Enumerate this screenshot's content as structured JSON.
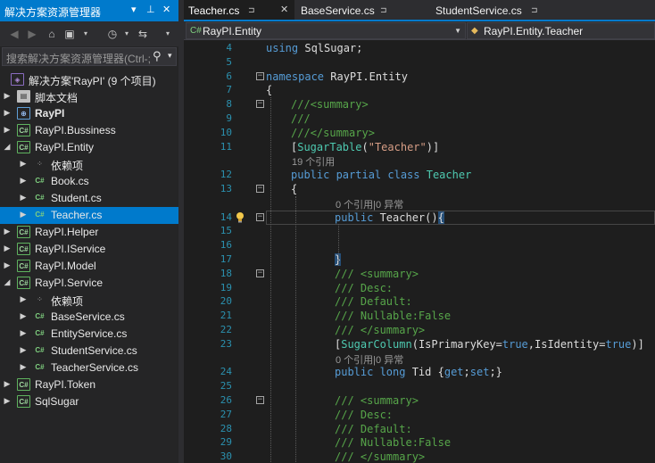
{
  "explorer": {
    "title": "解决方案资源管理器",
    "title_controls": [
      "▾",
      "⊥",
      "✕"
    ],
    "search_placeholder": "搜索解决方案资源管理器(Ctrl-;)",
    "toolbar_icons": [
      "back-icon",
      "forward-icon",
      "home-icon",
      "switch-view-icon",
      "history-icon",
      "sync-icon"
    ],
    "tree": [
      {
        "label": "解决方案'RayPI' (9 个项目)",
        "icon": "solution-icon",
        "ico": "◈",
        "indent": 0,
        "arrow": "",
        "bold": false,
        "selected": false
      },
      {
        "label": "脚本文档",
        "icon": "folder-doc-icon",
        "ico": "▤",
        "indent": 1,
        "arrow": "▶",
        "bold": false,
        "selected": false
      },
      {
        "label": "RayPI",
        "icon": "web-project-icon",
        "ico": "⊕",
        "indent": 1,
        "arrow": "▶",
        "bold": true,
        "selected": false
      },
      {
        "label": "RayPI.Bussiness",
        "icon": "csharp-project-icon",
        "ico": "C#",
        "indent": 1,
        "arrow": "▶",
        "bold": false,
        "selected": false
      },
      {
        "label": "RayPI.Entity",
        "icon": "csharp-project-icon",
        "ico": "C#",
        "indent": 1,
        "arrow": "◢",
        "bold": false,
        "selected": false
      },
      {
        "label": "依赖项",
        "icon": "dependencies-icon",
        "ico": "⁘",
        "indent": 2,
        "arrow": "▶",
        "bold": false,
        "selected": false
      },
      {
        "label": "Book.cs",
        "icon": "csharp-file-icon",
        "ico": "C#",
        "indent": 2,
        "arrow": "▶",
        "bold": false,
        "selected": false
      },
      {
        "label": "Student.cs",
        "icon": "csharp-file-icon",
        "ico": "C#",
        "indent": 2,
        "arrow": "▶",
        "bold": false,
        "selected": false
      },
      {
        "label": "Teacher.cs",
        "icon": "csharp-file-icon",
        "ico": "C#",
        "indent": 2,
        "arrow": "▶",
        "bold": false,
        "selected": true
      },
      {
        "label": "RayPI.Helper",
        "icon": "csharp-project-icon",
        "ico": "C#",
        "indent": 1,
        "arrow": "▶",
        "bold": false,
        "selected": false
      },
      {
        "label": "RayPI.IService",
        "icon": "csharp-project-icon",
        "ico": "C#",
        "indent": 1,
        "arrow": "▶",
        "bold": false,
        "selected": false
      },
      {
        "label": "RayPI.Model",
        "icon": "csharp-project-icon",
        "ico": "C#",
        "indent": 1,
        "arrow": "▶",
        "bold": false,
        "selected": false
      },
      {
        "label": "RayPI.Service",
        "icon": "csharp-project-icon",
        "ico": "C#",
        "indent": 1,
        "arrow": "◢",
        "bold": false,
        "selected": false
      },
      {
        "label": "依赖项",
        "icon": "dependencies-icon",
        "ico": "⁘",
        "indent": 2,
        "arrow": "▶",
        "bold": false,
        "selected": false
      },
      {
        "label": "BaseService.cs",
        "icon": "csharp-file-icon",
        "ico": "C#",
        "indent": 2,
        "arrow": "▶",
        "bold": false,
        "selected": false
      },
      {
        "label": "EntityService.cs",
        "icon": "csharp-file-icon",
        "ico": "C#",
        "indent": 2,
        "arrow": "▶",
        "bold": false,
        "selected": false
      },
      {
        "label": "StudentService.cs",
        "icon": "csharp-file-icon",
        "ico": "C#",
        "indent": 2,
        "arrow": "▶",
        "bold": false,
        "selected": false
      },
      {
        "label": "TeacherService.cs",
        "icon": "csharp-file-icon",
        "ico": "C#",
        "indent": 2,
        "arrow": "▶",
        "bold": false,
        "selected": false
      },
      {
        "label": "RayPI.Token",
        "icon": "csharp-project-icon",
        "ico": "C#",
        "indent": 1,
        "arrow": "▶",
        "bold": false,
        "selected": false
      },
      {
        "label": "SqlSugar",
        "icon": "csharp-project-icon",
        "ico": "C#",
        "indent": 1,
        "arrow": "▶",
        "bold": false,
        "selected": false
      }
    ]
  },
  "tabs": [
    {
      "label": "Teacher.cs",
      "pin": "⊐",
      "close": "✕",
      "active": true
    },
    {
      "label": "BaseService.cs",
      "pin": "⊐",
      "close": "",
      "active": false
    },
    {
      "label": "StudentService.cs",
      "pin": "⊐",
      "close": "",
      "active": false
    }
  ],
  "navbar": {
    "project": "RayPI.Entity",
    "type": "RayPI.Entity.Teacher"
  },
  "editor": {
    "lines": [
      {
        "n": "4",
        "fold": "",
        "indent": 0,
        "parts": [
          [
            "kw",
            "using"
          ],
          [
            "pl",
            " SqlSugar;"
          ]
        ]
      },
      {
        "n": "5",
        "fold": "",
        "indent": 0,
        "parts": []
      },
      {
        "n": "6",
        "fold": "−",
        "indent": 0,
        "parts": [
          [
            "kw",
            "namespace"
          ],
          [
            "pl",
            " RayPI.Entity"
          ]
        ]
      },
      {
        "n": "7",
        "fold": "",
        "indent": 0,
        "parts": [
          [
            "pl",
            "{"
          ]
        ]
      },
      {
        "n": "8",
        "fold": "−",
        "indent": 1,
        "parts": [
          [
            "doc",
            "///"
          ],
          [
            "tag",
            "<summary>"
          ]
        ]
      },
      {
        "n": "9",
        "fold": "",
        "indent": 1,
        "parts": [
          [
            "doc",
            "///"
          ]
        ]
      },
      {
        "n": "10",
        "fold": "",
        "indent": 1,
        "parts": [
          [
            "doc",
            "///"
          ],
          [
            "tag",
            "</summary>"
          ]
        ]
      },
      {
        "n": "11",
        "fold": "",
        "indent": 1,
        "parts": [
          [
            "pl",
            "["
          ],
          [
            "ty",
            "SugarTable"
          ],
          [
            "pl",
            "("
          ],
          [
            "str",
            "\"Teacher\""
          ],
          [
            "pl",
            ")]"
          ]
        ]
      },
      {
        "n": "",
        "lens": "19 个引用",
        "indent": 1
      },
      {
        "n": "12",
        "fold": "",
        "indent": 1,
        "parts": [
          [
            "kw",
            "public partial class"
          ],
          [
            "pl",
            " "
          ],
          [
            "ty",
            "Teacher"
          ]
        ]
      },
      {
        "n": "13",
        "fold": "−",
        "indent": 1,
        "parts": [
          [
            "pl",
            "{"
          ]
        ]
      },
      {
        "n": "",
        "lens": "0 个引用|0 异常",
        "indent": 2
      },
      {
        "n": "14",
        "fold": "−",
        "indent": 2,
        "bulb": true,
        "current": true,
        "parts": [
          [
            "kw",
            "public"
          ],
          [
            "pl",
            " Teacher()"
          ],
          [
            "brace",
            "{"
          ]
        ]
      },
      {
        "n": "15",
        "fold": "",
        "indent": 2,
        "parts": []
      },
      {
        "n": "16",
        "fold": "",
        "indent": 2,
        "parts": []
      },
      {
        "n": "17",
        "fold": "",
        "indent": 2,
        "parts": [
          [
            "brace",
            "}"
          ]
        ]
      },
      {
        "n": "18",
        "fold": "−",
        "indent": 2,
        "parts": [
          [
            "cm",
            "/// <summary>"
          ]
        ]
      },
      {
        "n": "19",
        "fold": "",
        "indent": 2,
        "parts": [
          [
            "cm",
            "/// Desc:"
          ]
        ]
      },
      {
        "n": "20",
        "fold": "",
        "indent": 2,
        "parts": [
          [
            "cm",
            "/// Default:"
          ]
        ]
      },
      {
        "n": "21",
        "fold": "",
        "indent": 2,
        "parts": [
          [
            "cm",
            "/// Nullable:False"
          ]
        ]
      },
      {
        "n": "22",
        "fold": "",
        "indent": 2,
        "parts": [
          [
            "cm",
            "/// </summary>"
          ]
        ]
      },
      {
        "n": "23",
        "fold": "",
        "indent": 2,
        "parts": [
          [
            "pl",
            "["
          ],
          [
            "ty",
            "SugarColumn"
          ],
          [
            "pl",
            "(IsPrimaryKey="
          ],
          [
            "kw",
            "true"
          ],
          [
            "pl",
            ",IsIdentity="
          ],
          [
            "kw",
            "true"
          ],
          [
            "pl",
            ")]"
          ]
        ]
      },
      {
        "n": "",
        "lens": "0 个引用|0 异常",
        "indent": 2
      },
      {
        "n": "24",
        "fold": "",
        "indent": 2,
        "parts": [
          [
            "kw",
            "public long"
          ],
          [
            "pl",
            " Tid {"
          ],
          [
            "kw",
            "get"
          ],
          [
            "pl",
            ";"
          ],
          [
            "kw",
            "set"
          ],
          [
            "pl",
            ";}"
          ]
        ]
      },
      {
        "n": "25",
        "fold": "",
        "indent": 2,
        "parts": []
      },
      {
        "n": "26",
        "fold": "−",
        "indent": 2,
        "parts": [
          [
            "cm",
            "/// <summary>"
          ]
        ]
      },
      {
        "n": "27",
        "fold": "",
        "indent": 2,
        "parts": [
          [
            "cm",
            "/// Desc:"
          ]
        ]
      },
      {
        "n": "28",
        "fold": "",
        "indent": 2,
        "parts": [
          [
            "cm",
            "/// Default:"
          ]
        ]
      },
      {
        "n": "29",
        "fold": "",
        "indent": 2,
        "parts": [
          [
            "cm",
            "/// Nullable:False"
          ]
        ]
      },
      {
        "n": "30",
        "fold": "",
        "indent": 2,
        "parts": [
          [
            "cm",
            "/// </summary>"
          ]
        ]
      }
    ]
  },
  "colors": {
    "accent": "#007acc",
    "keyword": "#569cd6",
    "type": "#4ec9b0",
    "string": "#d69d85",
    "comment": "#57a64a",
    "line_number": "#2b91af"
  }
}
